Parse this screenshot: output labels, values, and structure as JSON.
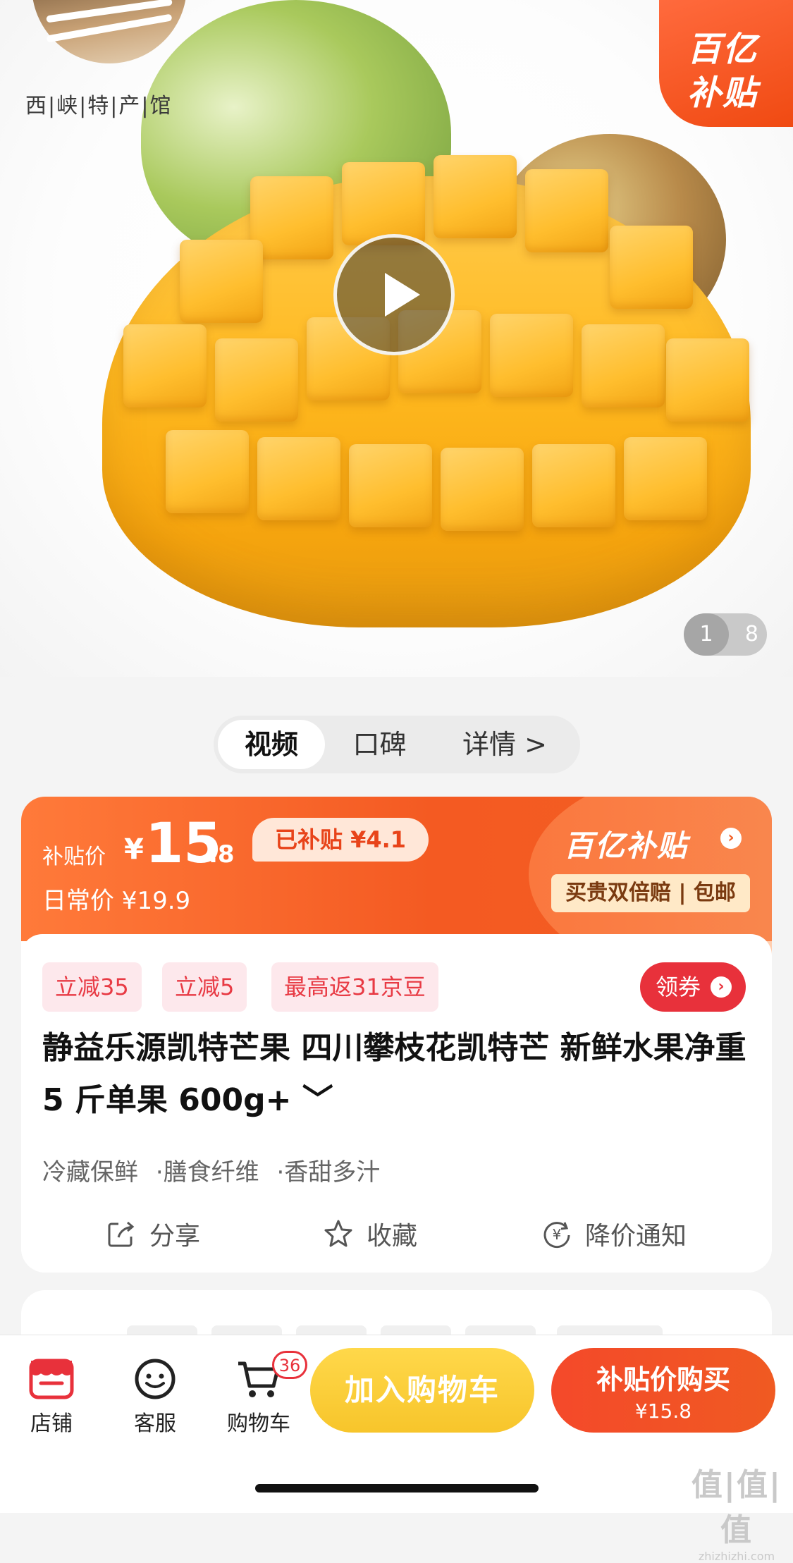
{
  "hero": {
    "logo_text": "西|峡|特|产|馆",
    "badge_line1": "百亿",
    "badge_line2": "补贴",
    "pager_current": "1",
    "pager_total": "8"
  },
  "tabs": [
    {
      "label": "视频",
      "active": true
    },
    {
      "label": "口碑",
      "active": false
    },
    {
      "label": "详情 >",
      "active": false
    }
  ],
  "price": {
    "label": "补贴价",
    "yen": "¥",
    "integer": "15",
    "decimal": ".8",
    "subsidized": "已补贴 ¥4.1",
    "regular": "日常价 ¥19.9",
    "brand": "百亿补贴",
    "tagline": "买贵双倍赔 | 包邮",
    "accent": "#f25e23"
  },
  "coupons": [
    {
      "label": "立减35"
    },
    {
      "label": "立减5"
    },
    {
      "label": "最高返31京豆"
    }
  ],
  "coupon_button": "领券",
  "product": {
    "title": "静益乐源凯特芒果 四川攀枝花凯特芒 新鲜水果净重 5 斤单果 600g+ ﹀",
    "features": [
      "冷藏保鲜",
      "·膳食纤维",
      "·香甜多汁"
    ]
  },
  "actions": {
    "share": "分享",
    "favorite": "收藏",
    "price_alert": "降价通知"
  },
  "bottom_bar": {
    "store": "店铺",
    "service": "客服",
    "cart": "购物车",
    "cart_count": "36",
    "add_to_cart": "加入购物车",
    "buy_label": "补贴价购买",
    "buy_price": "¥15.8"
  },
  "watermark": {
    "line1": "值|值|值",
    "line2": "zhizhizhi.com"
  }
}
